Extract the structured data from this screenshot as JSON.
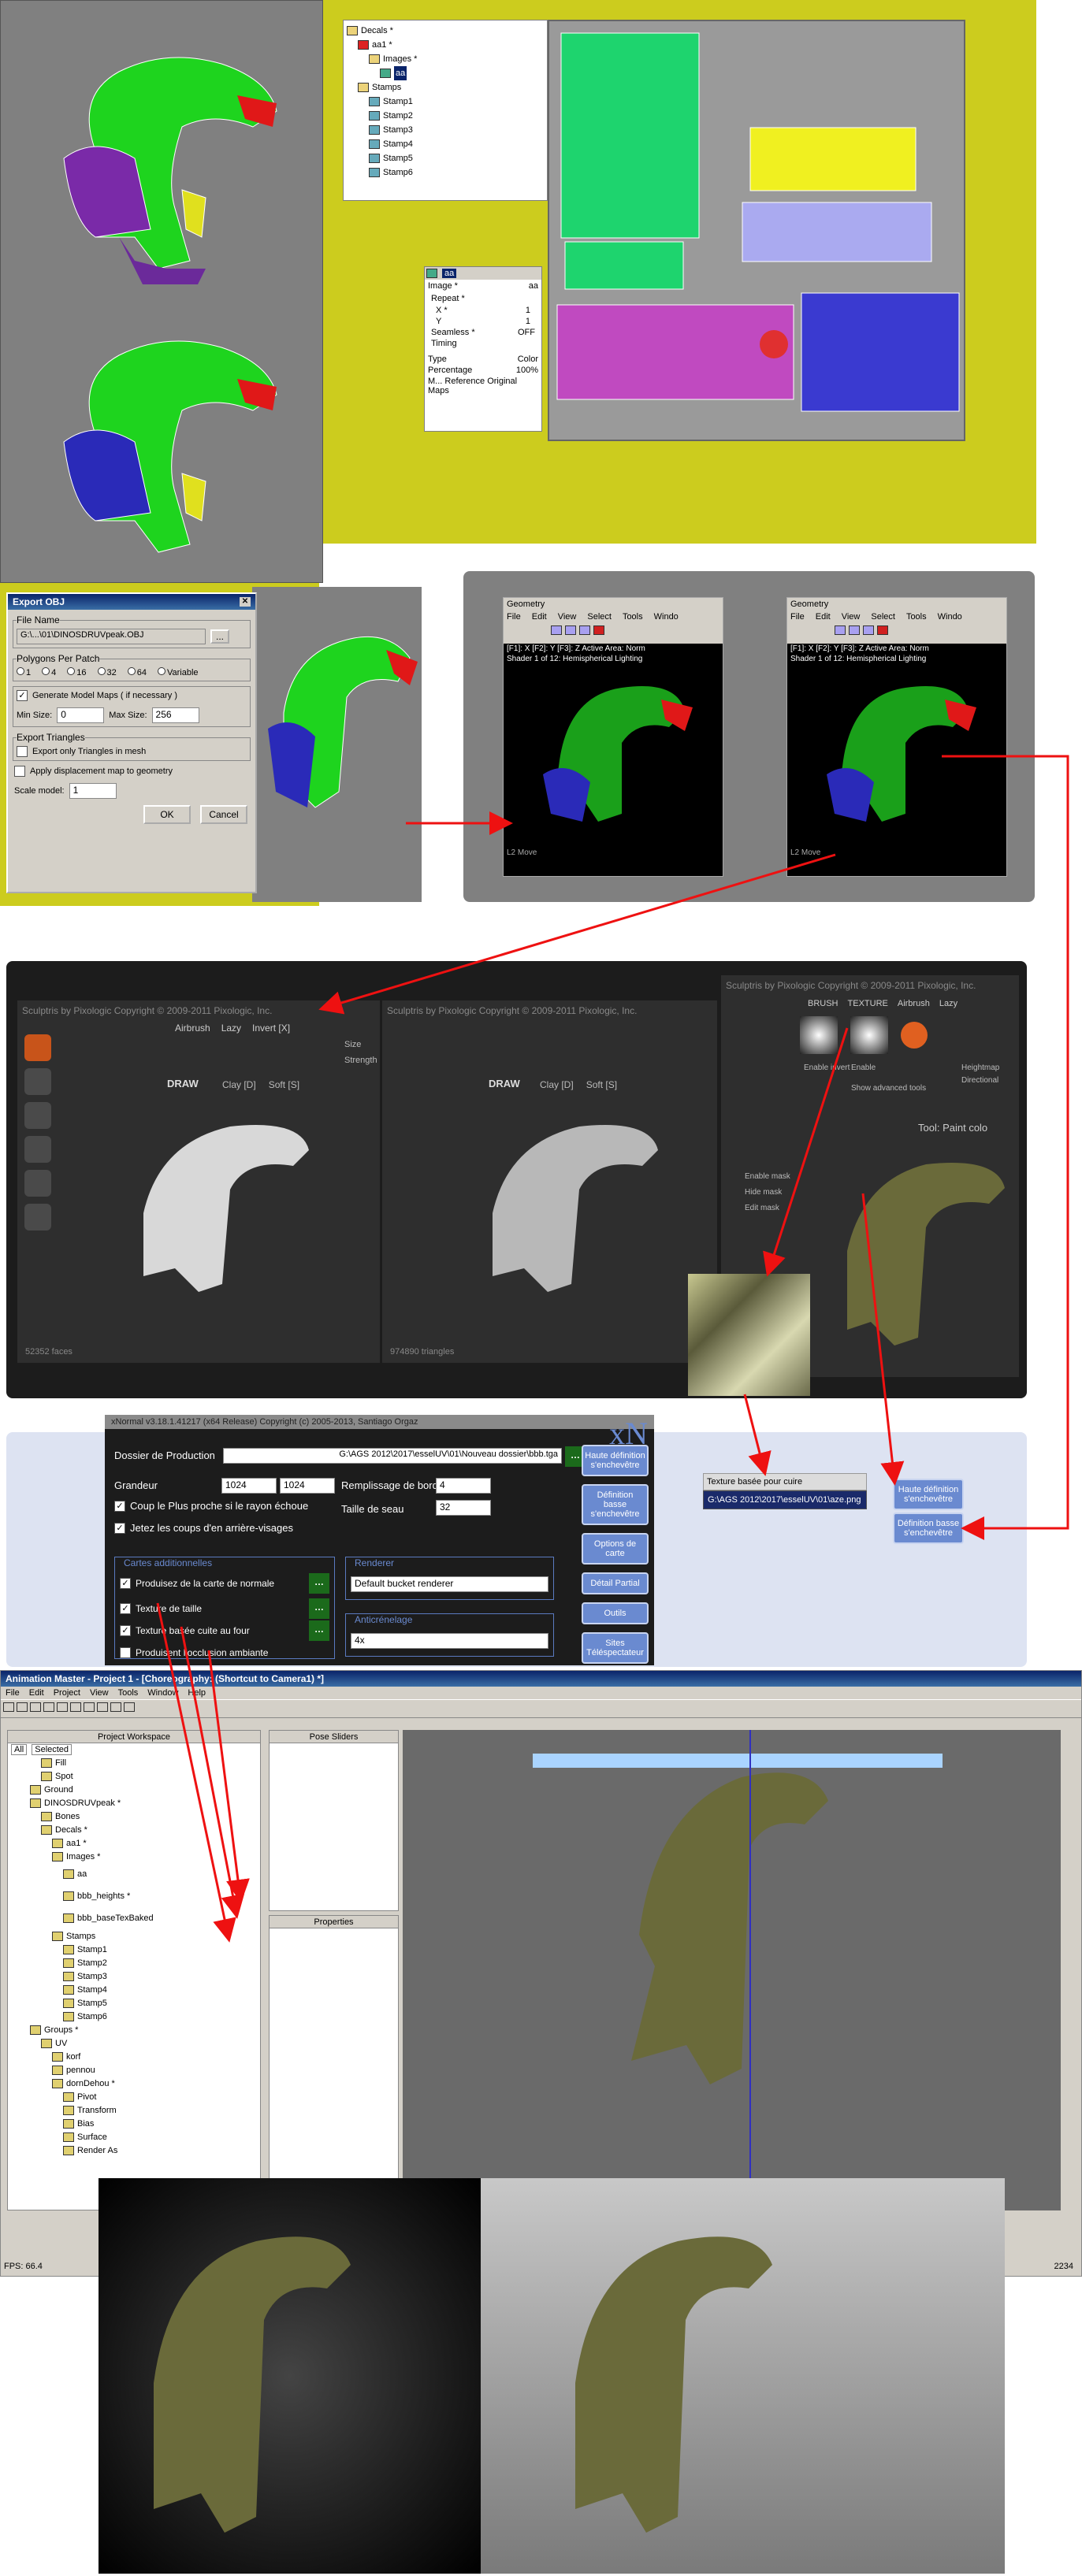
{
  "panel1": {
    "decals_tree": {
      "items": [
        {
          "label": "Decals *"
        },
        {
          "label": "aa1 *"
        },
        {
          "label": "Images *"
        },
        {
          "label": "aa"
        },
        {
          "label": "Stamps"
        },
        {
          "label": "Stamp1"
        },
        {
          "label": "Stamp2"
        },
        {
          "label": "Stamp3"
        },
        {
          "label": "Stamp4"
        },
        {
          "label": "Stamp5"
        },
        {
          "label": "Stamp6"
        }
      ]
    },
    "image_props": {
      "tab": "aa",
      "image_label": "Image *",
      "image_value": "aa",
      "repeat": "Repeat *",
      "x_label": "X *",
      "x_value": "1",
      "y_label": "Y",
      "y_value": "1",
      "seamless_label": "Seamless *",
      "seamless_value": "OFF",
      "timing": "Timing",
      "type_label": "Type",
      "type_value": "Color",
      "pct_label": "Percentage",
      "pct_value": "100%",
      "ref": "M... Reference Original Maps"
    },
    "export": {
      "title": "Export OBJ",
      "filename_group": "File Name",
      "filename": "G:\\...\\01\\DINOSDRUVpeak.OBJ",
      "browse": "...",
      "poly_group": "Polygons Per Patch",
      "poly_options": [
        "1",
        "4",
        "16",
        "32",
        "64",
        "Variable"
      ],
      "gen_maps": "Generate Model Maps ( if necessary )",
      "min_label": "Min Size:",
      "min_value": "0",
      "max_label": "Max Size:",
      "max_value": "256",
      "tri_group": "Export Triangles",
      "tri_only": "Export only Triangles in mesh",
      "displace": "Apply displacement map to geometry",
      "scale_label": "Scale model:",
      "scale_value": "1",
      "ok": "OK",
      "cancel": "Cancel"
    }
  },
  "panel2": {
    "viewers": [
      {
        "title": "Geometry",
        "menu": [
          "File",
          "Edit",
          "View",
          "Select",
          "Tools",
          "Windo"
        ],
        "keys": "[F1]: X  [F2]: Y  [F3]: Z  Active Area: Norm",
        "shader": "Shader 1 of 12: Hemispherical Lighting",
        "status": "L2 Move"
      },
      {
        "title": "Geometry",
        "menu": [
          "File",
          "Edit",
          "View",
          "Select",
          "Tools",
          "Windo"
        ],
        "keys": "[F1]: X  [F2]: Y  [F3]: Z  Active Area: Norm",
        "shader": "Shader 1 of 12: Hemispherical Lighting",
        "status": "L2 Move"
      }
    ]
  },
  "panel3": {
    "header": "Sculptris by Pixologic   Copyright © 2009-2011 Pixologic, Inc.",
    "airbrush": "Airbrush",
    "lazy": "Lazy",
    "invert": "Invert [X]",
    "size": "Size",
    "strength": "Strength",
    "draw": "DRAW",
    "clay": "Clay [D]",
    "soft": "Soft [S]",
    "faces1": "52352 faces",
    "faces2": "974890 triangles",
    "brush": "BRUSH",
    "texture": "TEXTURE",
    "enable_invert": "Enable invert",
    "enable": "Enable",
    "heightmap": "Heightmap",
    "directional": "Directional",
    "show_adv": "Show advanced tools",
    "paint_tool": "Tool: Paint colo",
    "mask_items": [
      "Enable mask",
      "Hide mask",
      "Edit mask"
    ]
  },
  "panel4": {
    "title": "xNormal v3.18.1.41217 (x64 Release) Copyright (c) 2005-2013, Santiago Orgaz",
    "logo": "xN",
    "dossier_label": "Dossier de Production",
    "dossier_value": "G:\\AGS 2012\\2017\\esselUV\\01\\Nouveau dossier\\bbb.tga",
    "grandeur_label": "Grandeur",
    "w": "1024",
    "h": "1024",
    "bord_label": "Remplissage de bord",
    "bord_value": "4",
    "chk1": "Coup le Plus proche si le rayon échoue",
    "chk2": "Jetez les coups d'en arrière-visages",
    "seau_label": "Taille de seau",
    "seau_value": "32",
    "cartes_group": "Cartes additionnelles",
    "cartes": [
      "Produisez de la carte de normale",
      "Texture de taille",
      "Texture basée cuite au four",
      "Produisent l'occlusion ambiante"
    ],
    "renderer_group": "Renderer",
    "renderer": "Default bucket renderer",
    "anti_group": "Anticrénelage",
    "anti": "4x",
    "side_buttons": [
      "Haute définition s'enchevêtre",
      "Définition basse s'enchevêtre",
      "Options de carte",
      "Détail Partial",
      "Outils",
      "Sites Téléspectateur"
    ],
    "ext_label": "Texture basée pour cuire",
    "ext_path": "G:\\AGS 2012\\2017\\esselUV\\01\\aze.png",
    "right_buttons": [
      "Haute définition s'enchevêtre",
      "Définition basse s'enchevêtre"
    ]
  },
  "panel5": {
    "title": "Animation Master - Project 1 - [Choreography: (Shortcut to Camera1) *]",
    "menu": [
      "File",
      "Edit",
      "Project",
      "View",
      "Tools",
      "Window",
      "Help"
    ],
    "workspace_title": "Project Workspace",
    "tabs": [
      "All",
      "Selected"
    ],
    "tree": [
      "Fill",
      "Spot",
      "Ground",
      "DINOSDRUVpeak *",
      "Bones",
      "Decals *",
      "aa1 *",
      "Images *",
      "aa",
      "bbb_heights *",
      "bbb_baseTexBaked",
      "Stamps",
      "Stamp1",
      "Stamp2",
      "Stamp3",
      "Stamp4",
      "Stamp5",
      "Stamp6",
      "Groups *",
      "UV",
      "korf",
      "pennou",
      "dornDehou *",
      "Pivot",
      "Transform",
      "Bias",
      "Surface",
      "Render As"
    ],
    "pose_title": "Pose Sliders",
    "props_title": "Properties",
    "fps": "FPS: 66.4",
    "coord": "2234"
  },
  "colors": {
    "yellow": "#cccc1e",
    "arrow": "#ee1111",
    "xnormal_bg": "#1c1c1c",
    "xnormal_panel": "#dde3f2"
  }
}
